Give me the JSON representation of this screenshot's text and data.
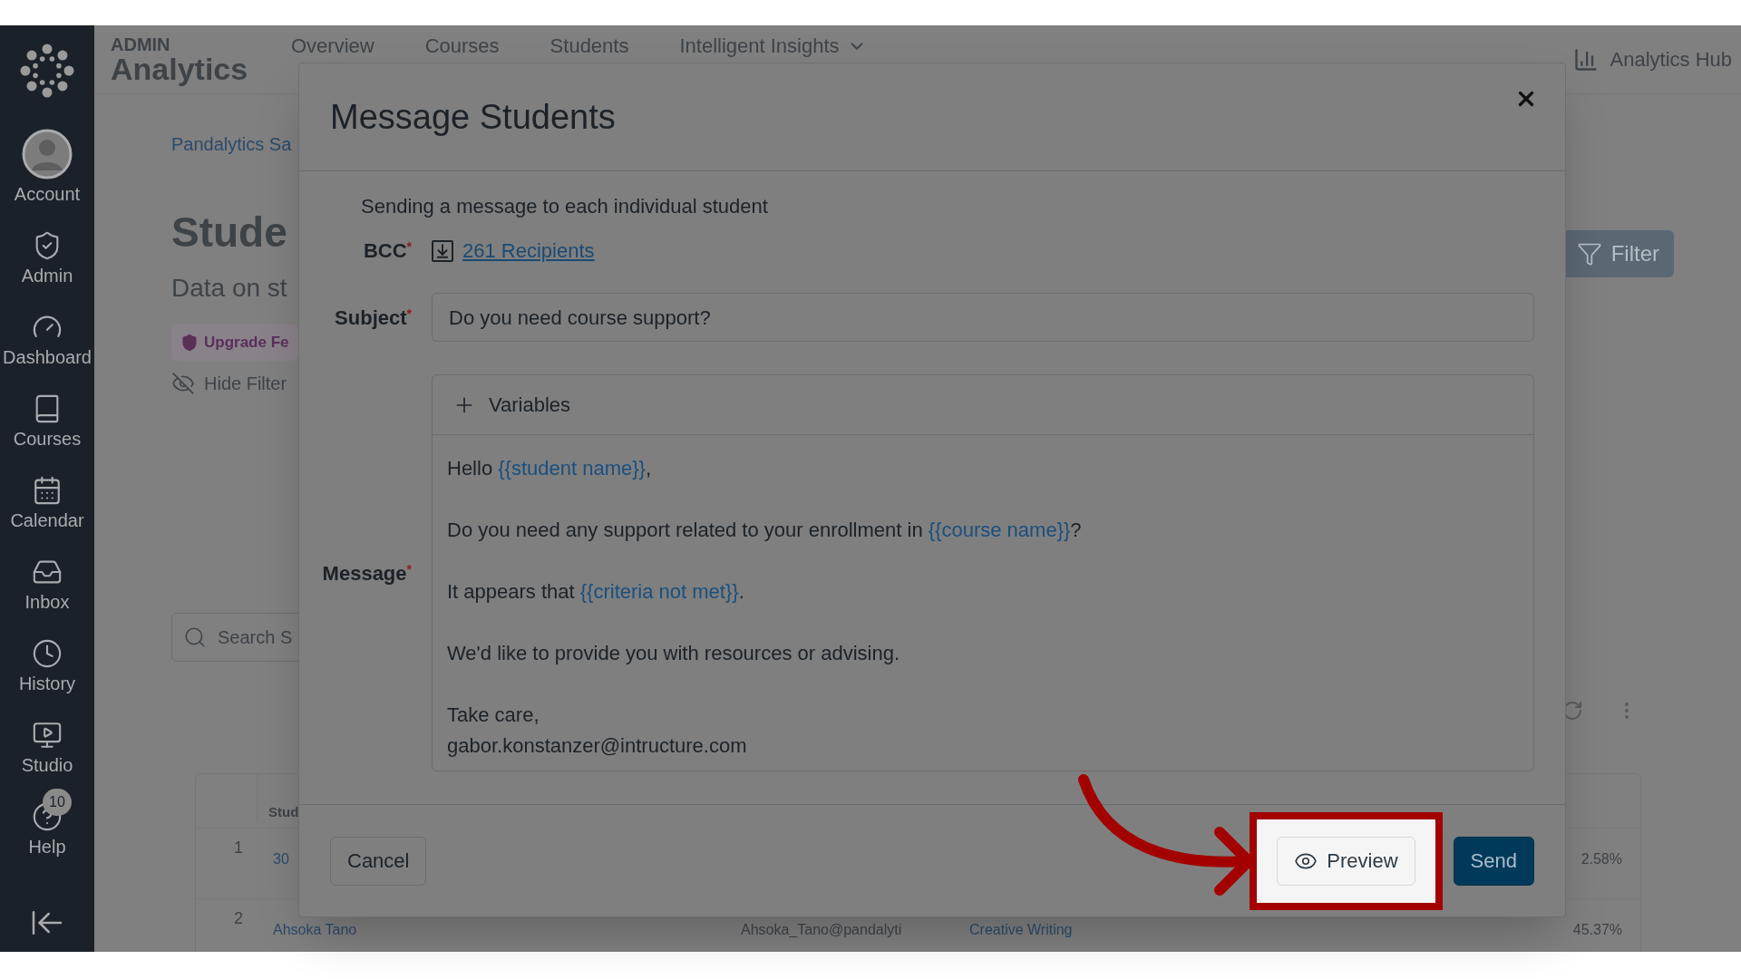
{
  "sidebar": {
    "items": [
      {
        "kind": "account",
        "label": "Account"
      },
      {
        "kind": "admin",
        "label": "Admin"
      },
      {
        "kind": "dashboard",
        "label": "Dashboard"
      },
      {
        "kind": "courses",
        "label": "Courses"
      },
      {
        "kind": "calendar",
        "label": "Calendar"
      },
      {
        "kind": "inbox",
        "label": "Inbox"
      },
      {
        "kind": "history",
        "label": "History"
      },
      {
        "kind": "studio",
        "label": "Studio"
      },
      {
        "kind": "help",
        "label": "Help",
        "badge": "10"
      }
    ]
  },
  "header": {
    "overline": "ADMIN",
    "title": "Analytics",
    "nav": [
      {
        "label": "Overview",
        "dropdown": false
      },
      {
        "label": "Courses",
        "dropdown": false
      },
      {
        "label": "Students",
        "dropdown": false
      },
      {
        "label": "Intelligent Insights",
        "dropdown": true
      }
    ],
    "hub_link": "Analytics Hub"
  },
  "page": {
    "breadcrumb": "Pandalytics Sa",
    "heading": "Stude",
    "subheading": "Data on st",
    "badge": "Upgrade Fe",
    "hide_filters": "Hide Filter",
    "filter_button": "Filter",
    "search": {
      "placeholder": "Search S"
    },
    "table": {
      "columns": [
        "Stud"
      ],
      "rows": [
        {
          "number": "1",
          "cells": [
            "30",
            "",
            "",
            "2.58%"
          ]
        },
        {
          "number": "2",
          "cells": [
            "Ahsoka Tano",
            "Ahsoka_Tano@pandalyti",
            "Creative Writing",
            "45.37%"
          ]
        }
      ]
    }
  },
  "modal": {
    "title": "Message Students",
    "intro": "Sending a message to each individual student",
    "bcc": {
      "label": "BCC",
      "required_mark": "*",
      "link": "261 Recipients"
    },
    "subject": {
      "label": "Subject",
      "required_mark": "*",
      "value": "Do you need course support?"
    },
    "message": {
      "label": "Message",
      "required_mark": "*",
      "toolbar": "Variables",
      "paragraphs": [
        [
          [
            {
              "kind": "plain",
              "text": "Hello "
            },
            {
              "kind": "variable",
              "text": "{{student name}}"
            },
            {
              "kind": "plain",
              "text": ","
            }
          ]
        ],
        [
          [
            {
              "kind": "plain",
              "text": "Do you need any support related to your enrollment in "
            },
            {
              "kind": "variable",
              "text": "{{course name}}"
            },
            {
              "kind": "plain",
              "text": "?"
            }
          ]
        ],
        [
          [
            {
              "kind": "plain",
              "text": "It appears that "
            },
            {
              "kind": "variable",
              "text": "{{criteria not met}}"
            },
            {
              "kind": "plain",
              "text": "."
            }
          ]
        ],
        [
          [
            {
              "kind": "plain",
              "text": "We'd like to provide you with resources or advising."
            }
          ]
        ],
        [
          [
            {
              "kind": "plain",
              "text": "Take care,"
            }
          ],
          [
            {
              "kind": "plain",
              "text": "gabor.konstanzer@intructure.com"
            }
          ]
        ]
      ]
    },
    "buttons": [
      {
        "kind": "secondary",
        "label": "Cancel",
        "highlighted": false
      },
      {
        "kind": "preview",
        "label": "Preview",
        "highlighted": true
      },
      {
        "kind": "primary",
        "label": "Send",
        "highlighted": false
      }
    ]
  }
}
